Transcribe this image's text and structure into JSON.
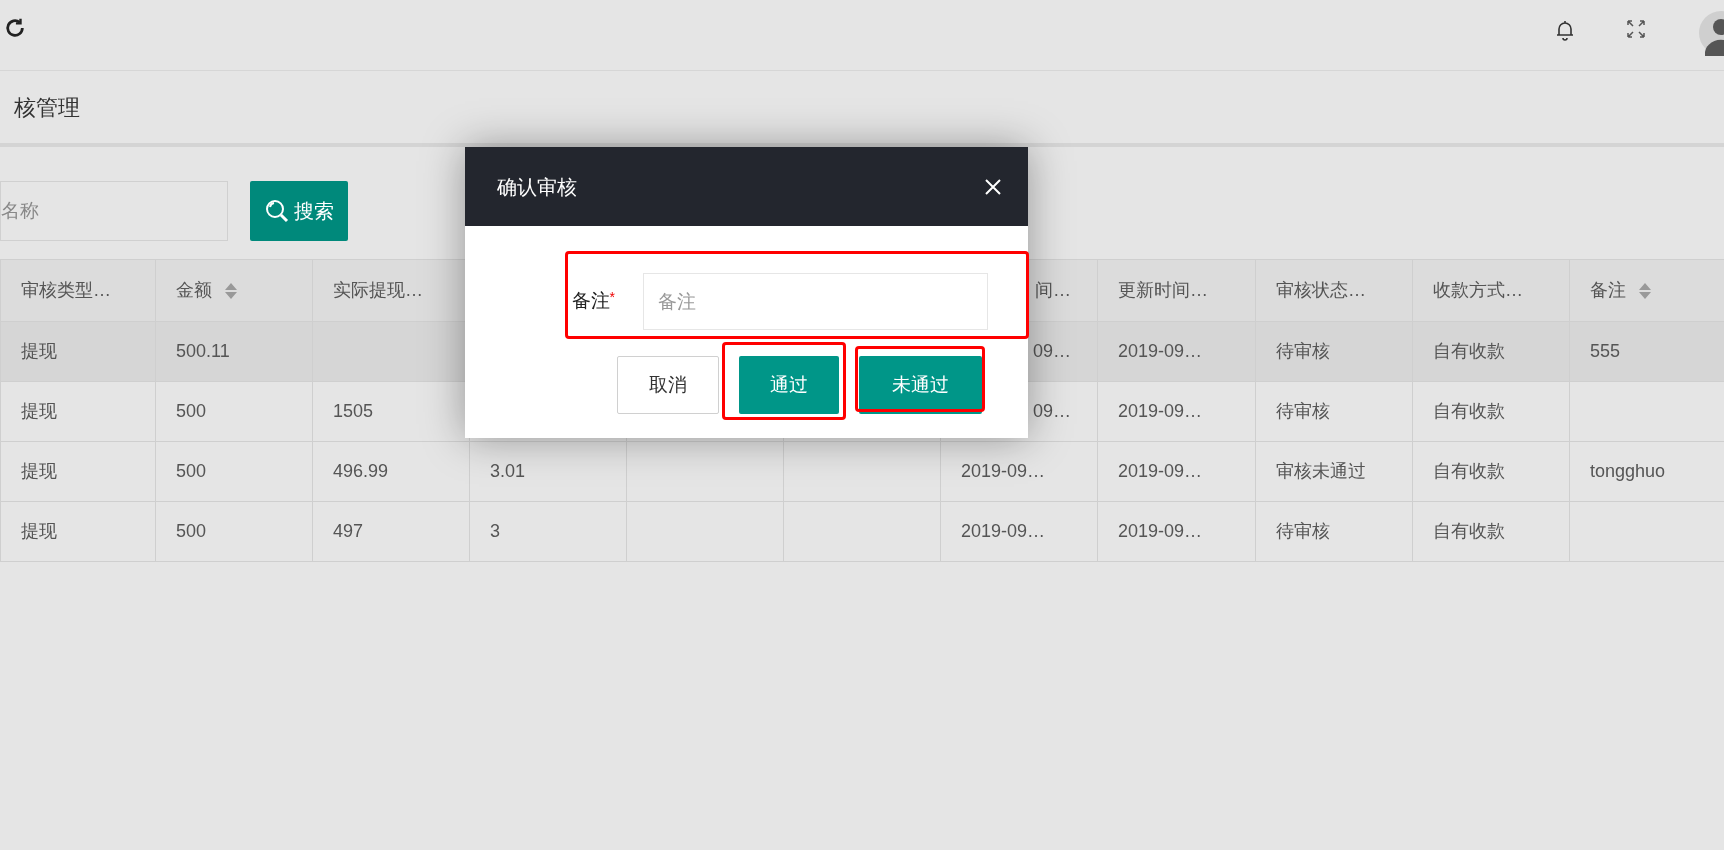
{
  "page_title": "核管理",
  "search": {
    "placeholder": "名称",
    "button": "搜索"
  },
  "table": {
    "columns": [
      {
        "label": "审核类型…"
      },
      {
        "label": "金额",
        "sortable": true
      },
      {
        "label": "实际提现…"
      },
      null,
      null,
      null,
      {
        "label": "间…",
        "clipped": true
      },
      {
        "label": "更新时间…"
      },
      {
        "label": "审核状态…"
      },
      {
        "label": "收款方式…"
      },
      {
        "label": "备注",
        "sortable": true
      }
    ],
    "rows": [
      {
        "selected": true,
        "cells": [
          "提现",
          "500.11",
          null,
          null,
          null,
          null,
          {
            "text": "09…",
            "clipped": true
          },
          "2019-09…",
          "待审核",
          "自有收款",
          "555"
        ]
      },
      {
        "selected": false,
        "cells": [
          "提现",
          "500",
          "1505",
          null,
          null,
          null,
          {
            "text": "09…",
            "clipped": true
          },
          "2019-09…",
          "待审核",
          "自有收款",
          null
        ]
      },
      {
        "selected": false,
        "cells": [
          "提现",
          "500",
          "496.99",
          "3.01",
          null,
          null,
          "2019-09…",
          "2019-09…",
          "审核未通过",
          "自有收款",
          "tongghuo"
        ]
      },
      {
        "selected": false,
        "cells": [
          "提现",
          "500",
          "497",
          "3",
          null,
          null,
          "2019-09…",
          "2019-09…",
          "待审核",
          "自有收款",
          null
        ]
      }
    ]
  },
  "dialog": {
    "title": "确认审核",
    "field": {
      "label": "备注",
      "required_mark": "*",
      "placeholder": "备注"
    },
    "buttons": [
      {
        "label": "取消",
        "kind": "plain"
      },
      {
        "label": "通过",
        "kind": "primary"
      },
      {
        "label": "未通过",
        "kind": "primary"
      }
    ]
  }
}
